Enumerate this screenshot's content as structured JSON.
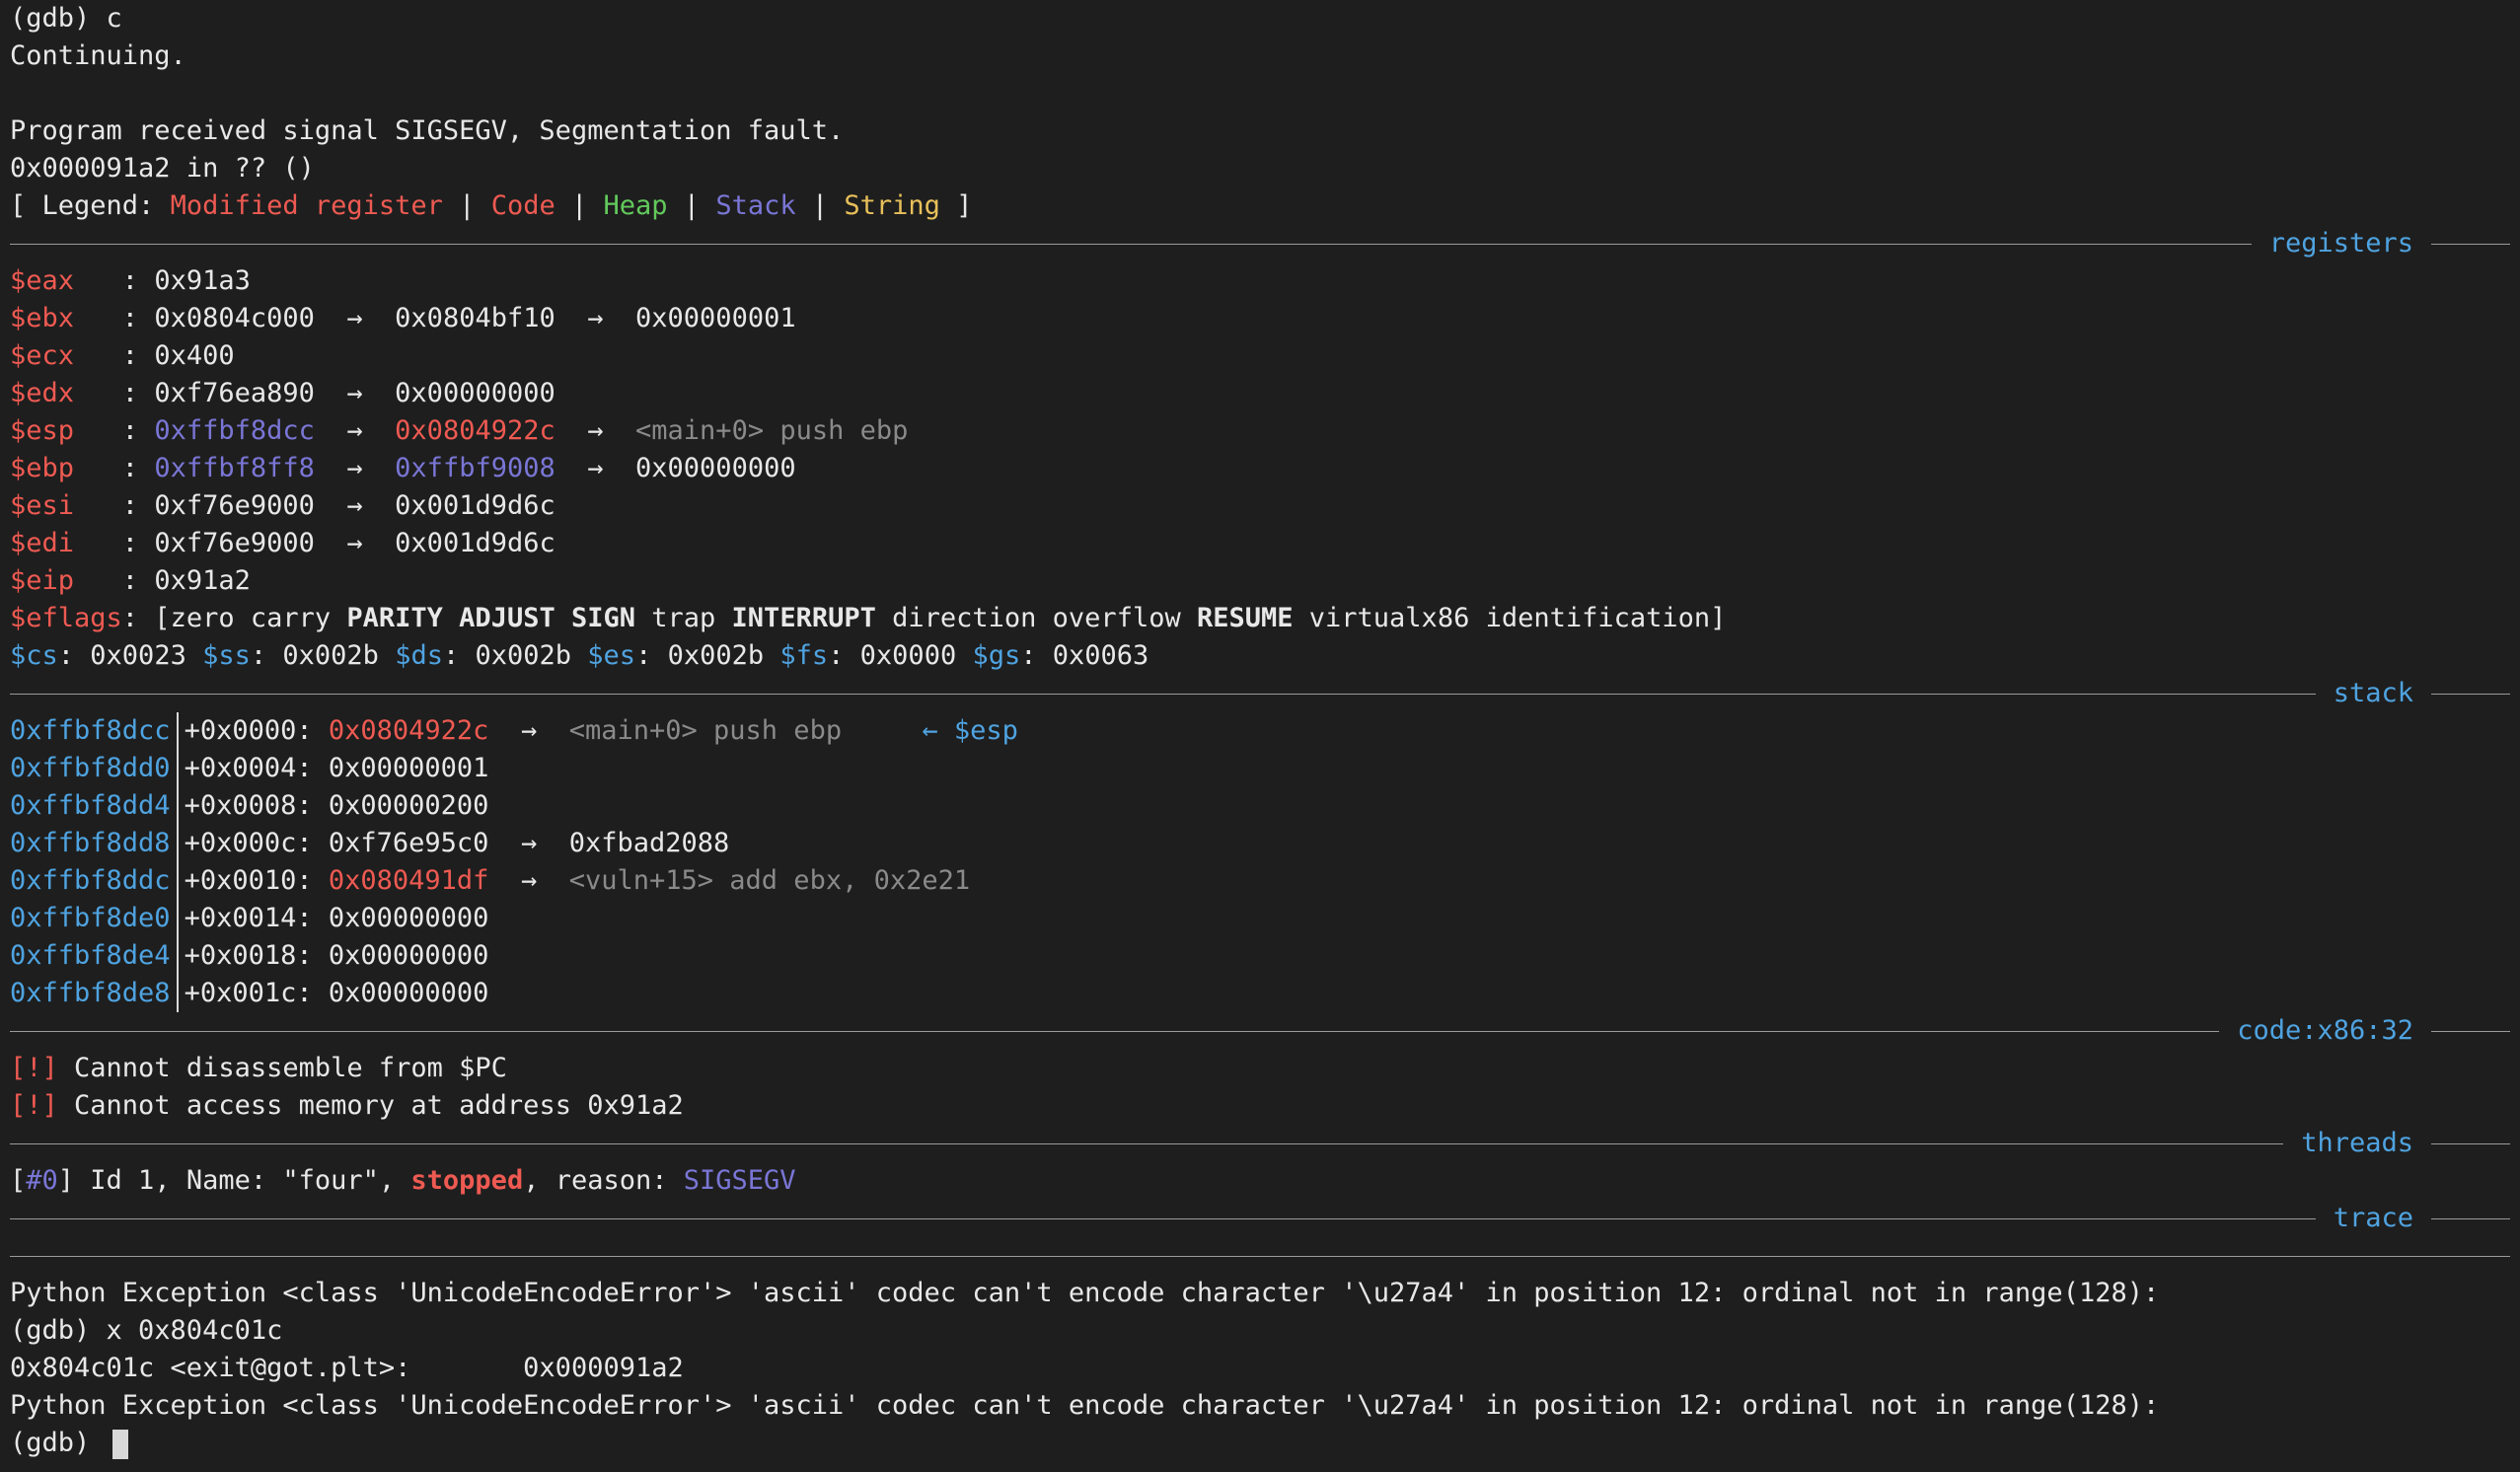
{
  "top": {
    "cmd": "(gdb) c",
    "continuing": "Continuing.",
    "signal": "Program received signal SIGSEGV, Segmentation fault.",
    "location": "0x000091a2 in ?? ()"
  },
  "legend": {
    "open": "[ Legend: ",
    "modified": "Modified register",
    "sep": " | ",
    "code": "Code",
    "heap": "Heap",
    "stack": "Stack",
    "string": "String",
    "close": " ]"
  },
  "sections": {
    "registers": "registers",
    "stack": "stack",
    "code": "code:x86:32",
    "threads": "threads",
    "trace": "trace"
  },
  "arrow": "→",
  "registers": [
    {
      "name": "$eax",
      "pad": "   : ",
      "v1": "0x91a3"
    },
    {
      "name": "$ebx",
      "pad": "   : ",
      "v1": "0x0804c000",
      "v2": "0x0804bf10",
      "v3": "0x00000001"
    },
    {
      "name": "$ecx",
      "pad": "   : ",
      "v1": "0x400"
    },
    {
      "name": "$edx",
      "pad": "   : ",
      "v1": "0xf76ea890",
      "v2": "0x00000000"
    },
    {
      "name": "$esp",
      "pad": "   : ",
      "v1": "0xffbf8dcc",
      "v2": "0x0804922c",
      "v3": "<main+0> push ebp"
    },
    {
      "name": "$ebp",
      "pad": "   : ",
      "v1": "0xffbf8ff8",
      "v2": "0xffbf9008",
      "v3": "0x00000000"
    },
    {
      "name": "$esi",
      "pad": "   : ",
      "v1": "0xf76e9000",
      "v2": "0x001d9d6c"
    },
    {
      "name": "$edi",
      "pad": "   : ",
      "v1": "0xf76e9000",
      "v2": "0x001d9d6c"
    },
    {
      "name": "$eip",
      "pad": "   : ",
      "v1": "0x91a2"
    }
  ],
  "eflags": {
    "name": "$eflags",
    "open": ": [",
    "f1": "zero carry ",
    "f2": "PARITY ADJUST SIGN",
    "f3": " trap ",
    "f4": "INTERRUPT",
    "f5": " direction overflow ",
    "f6": "RESUME",
    "f7": " virtualx86 identification]"
  },
  "segments": [
    {
      "name": "$cs",
      "value": ": 0x0023 "
    },
    {
      "name": "$ss",
      "value": ": 0x002b "
    },
    {
      "name": "$ds",
      "value": ": 0x002b "
    },
    {
      "name": "$es",
      "value": ": 0x002b "
    },
    {
      "name": "$fs",
      "value": ": 0x0000 "
    },
    {
      "name": "$gs",
      "value": ": 0x0063"
    }
  ],
  "stack": [
    {
      "addr": "0xffbf8dcc",
      "off": "+0x0000: ",
      "val": "0x0804922c",
      "deref": "<main+0> push ebp",
      "marker": "← $esp"
    },
    {
      "addr": "0xffbf8dd0",
      "off": "+0x0004: ",
      "val": "0x00000001"
    },
    {
      "addr": "0xffbf8dd4",
      "off": "+0x0008: ",
      "val": "0x00000200"
    },
    {
      "addr": "0xffbf8dd8",
      "off": "+0x000c: ",
      "val": "0xf76e95c0",
      "deref": "0xfbad2088"
    },
    {
      "addr": "0xffbf8ddc",
      "off": "+0x0010: ",
      "val": "0x080491df",
      "deref": "<vuln+15> add ebx, 0x2e21"
    },
    {
      "addr": "0xffbf8de0",
      "off": "+0x0014: ",
      "val": "0x00000000"
    },
    {
      "addr": "0xffbf8de4",
      "off": "+0x0018: ",
      "val": "0x00000000"
    },
    {
      "addr": "0xffbf8de8",
      "off": "+0x001c: ",
      "val": "0x00000000"
    }
  ],
  "code": {
    "tag": "[!]",
    "msg1": " Cannot disassemble from $PC",
    "msg2": " Cannot access memory at address 0x91a2"
  },
  "thread": {
    "open": "[",
    "id": "#0",
    "mid": "] Id 1, Name: \"four\", ",
    "state": "stopped",
    "reason_label": ", reason: ",
    "reason": "SIGSEGV"
  },
  "bottom": {
    "exception": "Python Exception <class 'UnicodeEncodeError'> 'ascii' codec can't encode character '\\u27a4' in position 12: ordinal not in range(128):",
    "cmd": "(gdb) x 0x804c01c",
    "result": "0x804c01c <exit@got.plt>:       0x000091a2",
    "exception2": "Python Exception <class 'UnicodeEncodeError'> 'ascii' codec can't encode character '\\u27a4' in position 12: ordinal not in range(128):",
    "prompt": "(gdb) "
  }
}
